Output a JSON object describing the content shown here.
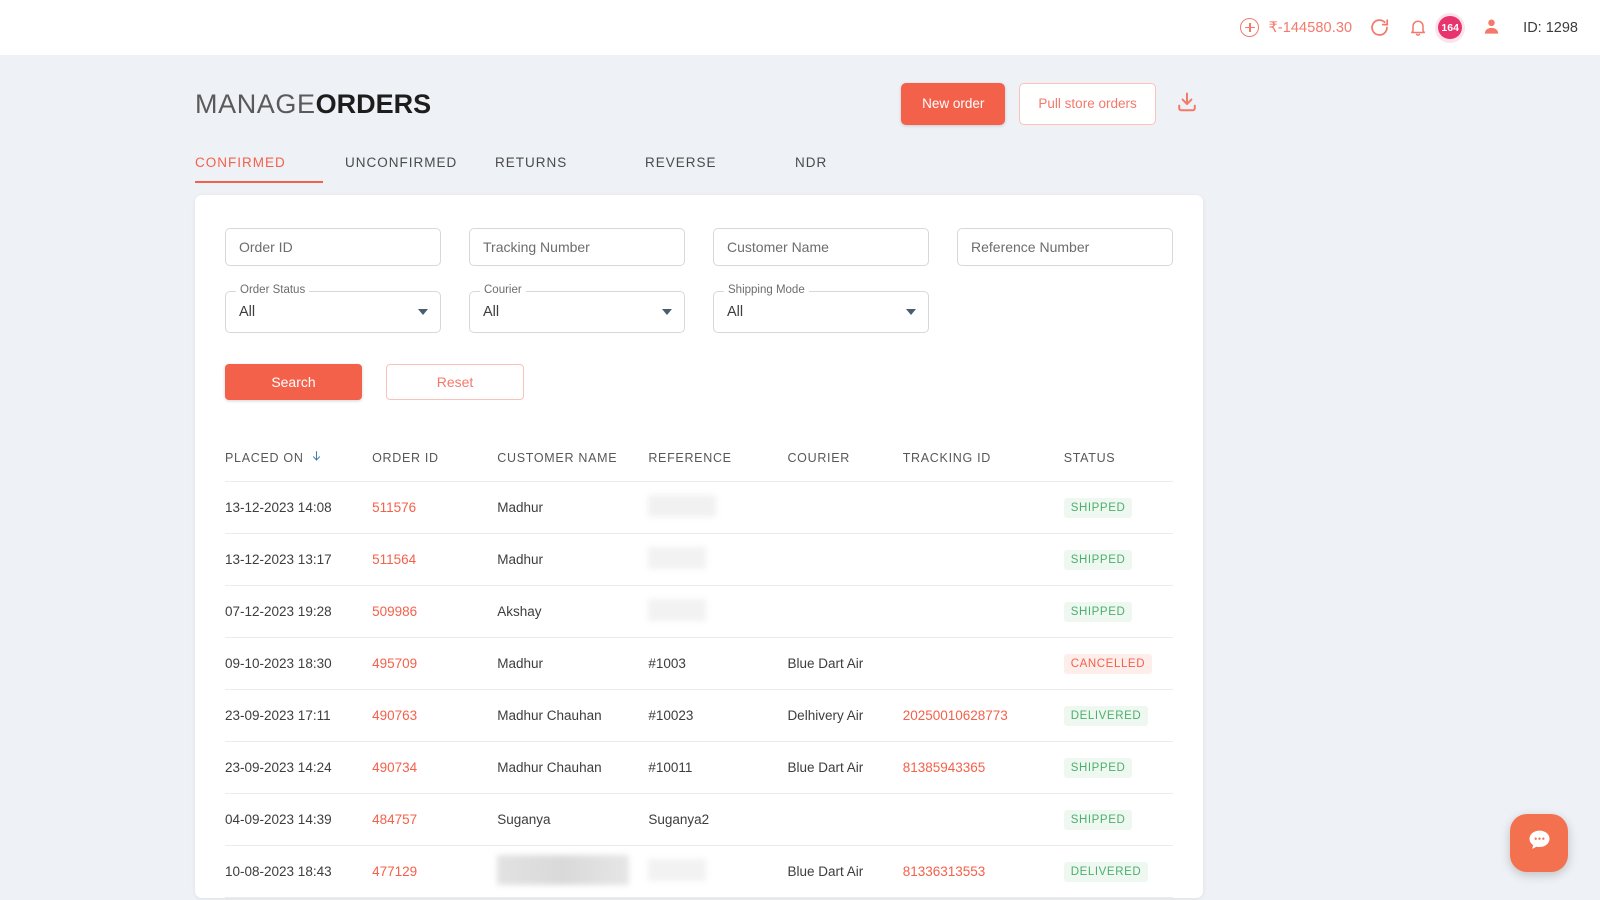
{
  "topbar": {
    "wallet_icon": "plus-circle-icon",
    "wallet_balance": "₹-144580.30",
    "refresh_icon": "refresh-icon",
    "bell_icon": "bell-icon",
    "notification_count": "164",
    "user_icon": "user-icon",
    "user_id": "ID: 1298",
    "accent": "#f4796b",
    "badge_color": "#e8336d"
  },
  "header": {
    "title_light": "MANAGE",
    "title_bold": "ORDERS",
    "new_order_label": "New order",
    "pull_store_orders_label": "Pull store orders",
    "download_icon": "download-icon",
    "primary_color": "#f4614b"
  },
  "tabs": {
    "items": [
      {
        "label": "CONFIRMED",
        "active": true
      },
      {
        "label": "UNCONFIRMED",
        "active": false
      },
      {
        "label": "RETURNS",
        "active": false
      },
      {
        "label": "REVERSE",
        "active": false
      },
      {
        "label": "NDR",
        "active": false
      }
    ]
  },
  "filters": {
    "text_inputs": [
      {
        "name": "order-id",
        "placeholder": "Order ID",
        "value": ""
      },
      {
        "name": "tracking-number",
        "placeholder": "Tracking Number",
        "value": ""
      },
      {
        "name": "customer-name",
        "placeholder": "Customer Name",
        "value": ""
      },
      {
        "name": "reference-number",
        "placeholder": "Reference Number",
        "value": ""
      }
    ],
    "selects": [
      {
        "name": "order-status",
        "label": "Order Status",
        "value": "All"
      },
      {
        "name": "courier",
        "label": "Courier",
        "value": "All"
      },
      {
        "name": "shipping-mode",
        "label": "Shipping Mode",
        "value": "All"
      }
    ],
    "search_label": "Search",
    "reset_label": "Reset"
  },
  "table": {
    "columns": [
      "PLACED ON",
      "ORDER ID",
      "CUSTOMER NAME",
      "REFERENCE",
      "COURIER",
      "TRACKING ID",
      "STATUS"
    ],
    "sort_column": "PLACED ON",
    "sort_direction": "descending",
    "sort_icon": "arrow-down-icon",
    "rows": [
      {
        "placed_on": "13-12-2023 14:08",
        "order_id": "511576",
        "customer_name": "Madhur",
        "reference": "",
        "reference_redacted": "sm",
        "courier": "",
        "tracking_id": "",
        "status": "SHIPPED",
        "status_type": "shipped"
      },
      {
        "placed_on": "13-12-2023 13:17",
        "order_id": "511564",
        "customer_name": "Madhur",
        "reference": "",
        "reference_redacted": "md",
        "courier": "",
        "tracking_id": "",
        "status": "SHIPPED",
        "status_type": "shipped"
      },
      {
        "placed_on": "07-12-2023 19:28",
        "order_id": "509986",
        "customer_name": "Akshay",
        "reference": "",
        "reference_redacted": "md",
        "courier": "",
        "tracking_id": "",
        "status": "SHIPPED",
        "status_type": "shipped"
      },
      {
        "placed_on": "09-10-2023 18:30",
        "order_id": "495709",
        "customer_name": "Madhur",
        "reference": "#1003",
        "reference_redacted": "",
        "courier": "Blue Dart Air",
        "tracking_id": "",
        "status": "CANCELLED",
        "status_type": "cancelled"
      },
      {
        "placed_on": "23-09-2023 17:11",
        "order_id": "490763",
        "customer_name": "Madhur Chauhan",
        "reference": "#10023",
        "reference_redacted": "",
        "courier": "Delhivery Air",
        "tracking_id": "20250010628773",
        "status": "DELIVERED",
        "status_type": "delivered"
      },
      {
        "placed_on": "23-09-2023 14:24",
        "order_id": "490734",
        "customer_name": "Madhur Chauhan",
        "reference": "#10011",
        "reference_redacted": "",
        "courier": "Blue Dart Air",
        "tracking_id": "81385943365",
        "status": "SHIPPED",
        "status_type": "shipped"
      },
      {
        "placed_on": "04-09-2023 14:39",
        "order_id": "484757",
        "customer_name": "Suganya",
        "reference": "Suganya2",
        "reference_redacted": "",
        "courier": "",
        "tracking_id": "",
        "status": "SHIPPED",
        "status_type": "shipped"
      },
      {
        "placed_on": "10-08-2023 18:43",
        "order_id": "477129",
        "customer_name": "",
        "customer_redacted": "lg",
        "reference": "",
        "reference_redacted": "md",
        "courier": "Blue Dart Air",
        "tracking_id": "81336313553",
        "status": "DELIVERED",
        "status_type": "delivered"
      }
    ]
  },
  "chat": {
    "icon": "chat-bubble-icon",
    "color": "#f4714f"
  }
}
